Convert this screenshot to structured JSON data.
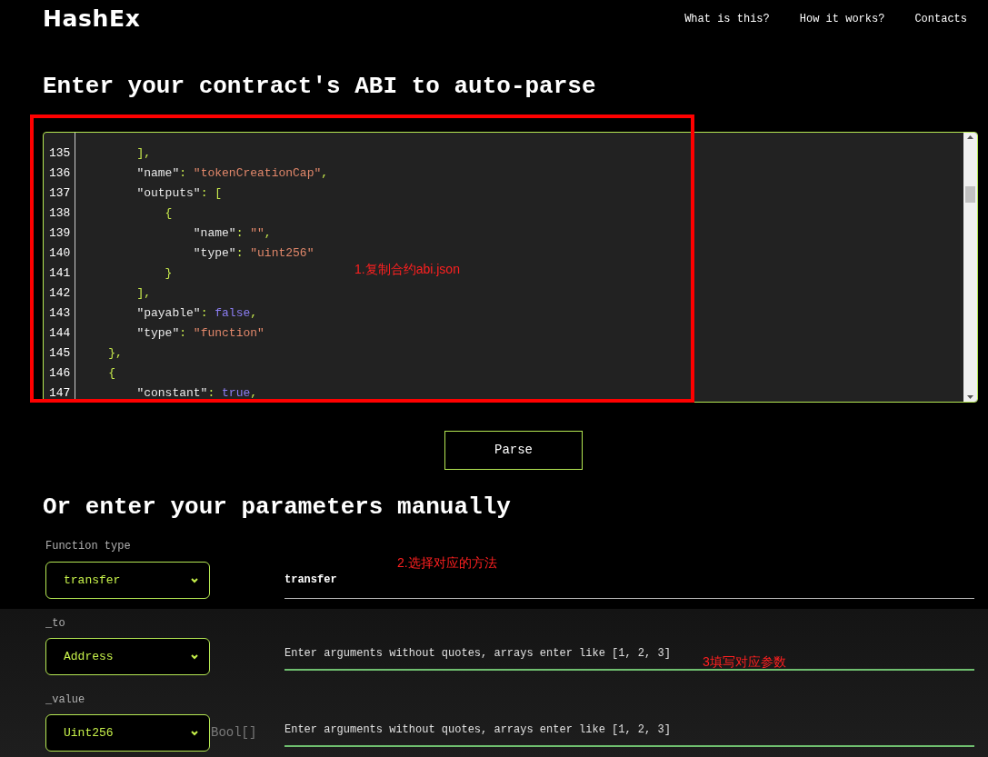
{
  "header": {
    "logo": "HashEx",
    "nav": [
      "What is this?",
      "How it works?",
      "Contacts"
    ]
  },
  "abi_section": {
    "title": "Enter your contract's ABI to auto-parse",
    "editor": {
      "lines": [
        {
          "number": "135",
          "tokens": [
            {
              "kind": "punct",
              "text": "        ],"
            }
          ]
        },
        {
          "number": "136",
          "tokens": [
            {
              "kind": "key",
              "text": "        \"name\""
            },
            {
              "kind": "punct",
              "text": ": "
            },
            {
              "kind": "string",
              "text": "\"tokenCreationCap\""
            },
            {
              "kind": "punct",
              "text": ","
            }
          ]
        },
        {
          "number": "137",
          "tokens": [
            {
              "kind": "key",
              "text": "        \"outputs\""
            },
            {
              "kind": "punct",
              "text": ": ["
            }
          ]
        },
        {
          "number": "138",
          "tokens": [
            {
              "kind": "punct",
              "text": "            {"
            }
          ]
        },
        {
          "number": "139",
          "tokens": [
            {
              "kind": "key",
              "text": "                \"name\""
            },
            {
              "kind": "punct",
              "text": ": "
            },
            {
              "kind": "string",
              "text": "\"\""
            },
            {
              "kind": "punct",
              "text": ","
            }
          ]
        },
        {
          "number": "140",
          "tokens": [
            {
              "kind": "key",
              "text": "                \"type\""
            },
            {
              "kind": "punct",
              "text": ": "
            },
            {
              "kind": "string",
              "text": "\"uint256\""
            }
          ]
        },
        {
          "number": "141",
          "tokens": [
            {
              "kind": "punct",
              "text": "            }"
            }
          ]
        },
        {
          "number": "142",
          "tokens": [
            {
              "kind": "punct",
              "text": "        ],"
            }
          ]
        },
        {
          "number": "143",
          "tokens": [
            {
              "kind": "key",
              "text": "        \"payable\""
            },
            {
              "kind": "punct",
              "text": ": "
            },
            {
              "kind": "literal",
              "text": "false"
            },
            {
              "kind": "punct",
              "text": ","
            }
          ]
        },
        {
          "number": "144",
          "tokens": [
            {
              "kind": "key",
              "text": "        \"type\""
            },
            {
              "kind": "punct",
              "text": ": "
            },
            {
              "kind": "string",
              "text": "\"function\""
            }
          ]
        },
        {
          "number": "145",
          "tokens": [
            {
              "kind": "punct",
              "text": "    },"
            }
          ]
        },
        {
          "number": "146",
          "tokens": [
            {
              "kind": "punct",
              "text": "    {"
            }
          ]
        },
        {
          "number": "147",
          "tokens": [
            {
              "kind": "key",
              "text": "        \"constant\""
            },
            {
              "kind": "punct",
              "text": ": "
            },
            {
              "kind": "literal",
              "text": "true"
            },
            {
              "kind": "punct",
              "text": ","
            }
          ]
        }
      ]
    },
    "parse_button": "Parse"
  },
  "manual_section": {
    "title": "Or enter your parameters manually",
    "function_type": {
      "label": "Function type",
      "value": "transfer"
    },
    "function_name": "transfer",
    "params": [
      {
        "label": "_to",
        "type": "Address",
        "placeholder": "Enter arguments without quotes, arrays enter like [1, 2, 3]"
      },
      {
        "label": "_value",
        "type": "Uint256",
        "placeholder": "Enter arguments without quotes, arrays enter like [1, 2, 3]",
        "ghost_option": "Bool[]"
      }
    ]
  },
  "annotations": [
    "1.复制合约abi.json",
    "2.选择对应的方法",
    "3填写对应参数"
  ]
}
